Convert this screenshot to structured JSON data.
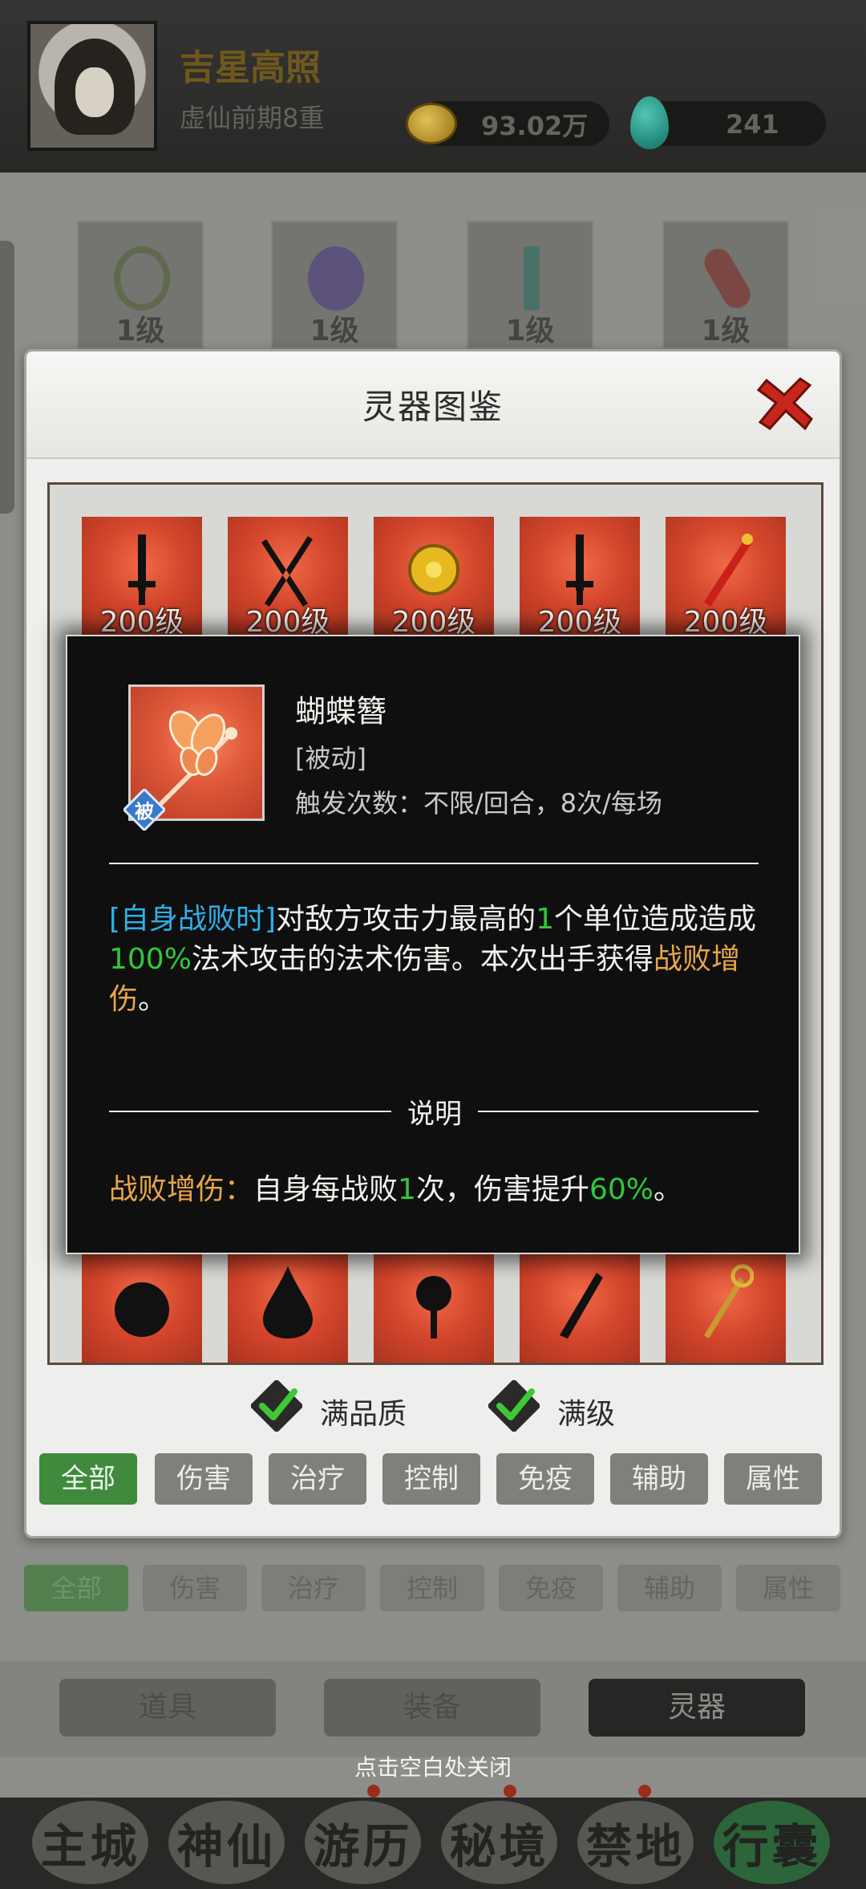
{
  "player": {
    "title": "吉星高照",
    "rank": "虚仙前期8重",
    "coins": "93.02万",
    "jade": "241"
  },
  "equipped": [
    {
      "level": "1级"
    },
    {
      "level": "1级"
    },
    {
      "level": "1级"
    },
    {
      "level": "1级"
    }
  ],
  "background_filters": [
    "全部",
    "伤害",
    "治疗",
    "控制",
    "免疫",
    "辅助",
    "属性"
  ],
  "bottom_tabs": {
    "items": "道具",
    "equipment": "装备",
    "spirit": "灵器"
  },
  "nav": [
    "主城",
    "神仙",
    "游历",
    "秘境",
    "禁地",
    "行囊"
  ],
  "close_hint": "点击空白处关闭",
  "dialog": {
    "title": "灵器图鉴",
    "grid_level_label": "200级",
    "checks": {
      "full_quality": "满品质",
      "full_level": "满级"
    },
    "filters": [
      "全部",
      "伤害",
      "治疗",
      "控制",
      "免疫",
      "辅助",
      "属性"
    ],
    "active_filter": "全部"
  },
  "detail": {
    "name": "蝴蝶簪",
    "type": "[被动]",
    "trigger": "触发次数：不限/回合，8次/每场",
    "badge": "被",
    "effect": {
      "tag": "[自身战败时]",
      "part1": "对敌方攻击力最高的",
      "count": "1",
      "part2": "个单位造成造成",
      "percent": "100%",
      "part3": "法术攻击的法术伤害。本次出手获得",
      "buff": "战败增伤",
      "end": "。"
    },
    "note_title": "说明",
    "note": {
      "term": "战败增伤：",
      "part1": "自身每战败",
      "count": "1",
      "part2": "次，伤害提升",
      "percent": "60%",
      "end": "。"
    }
  },
  "colors": {
    "accent_green": "#30c83a",
    "accent_blue": "#2fb0e8",
    "accent_gold": "#e8a64a",
    "cell_red": "#d4462c"
  }
}
